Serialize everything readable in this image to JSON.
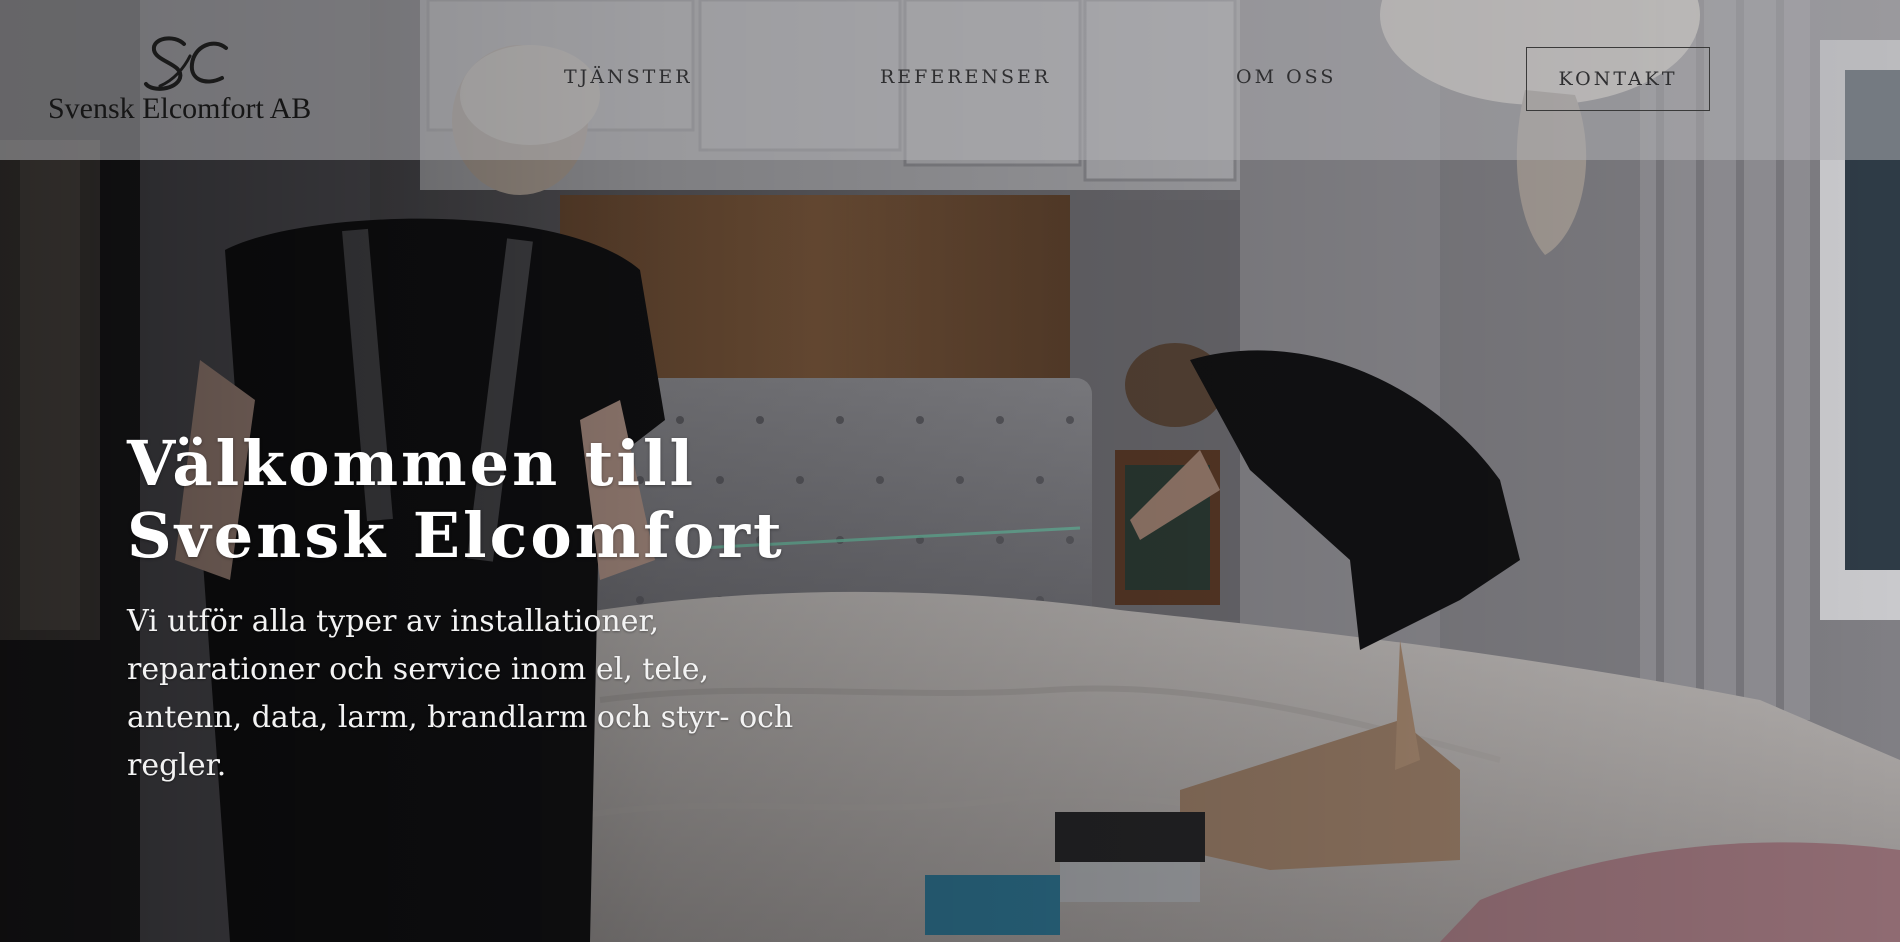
{
  "brand": {
    "name": "Svensk Elcomfort AB",
    "logo_icon": "se-monogram-logo-icon"
  },
  "nav": {
    "items": [
      {
        "label": "TJÄNSTER"
      },
      {
        "label": "REFERENSER"
      },
      {
        "label": "OM OSS"
      }
    ],
    "cta_label": "KONTAKT"
  },
  "hero": {
    "title_line1": "Välkommen till",
    "title_line2": "Svensk Elcomfort",
    "subtitle": "Vi utför alla typer av installationer, reparationer och service inom el, tele, antenn, data, larm, brandlarm och styr- och regler.",
    "background_icon": "hero-photo-electricians-bedroom"
  },
  "colors": {
    "nav_overlay": "#afafb2",
    "nav_text": "#2e2e30",
    "hero_text": "#ffffff"
  }
}
